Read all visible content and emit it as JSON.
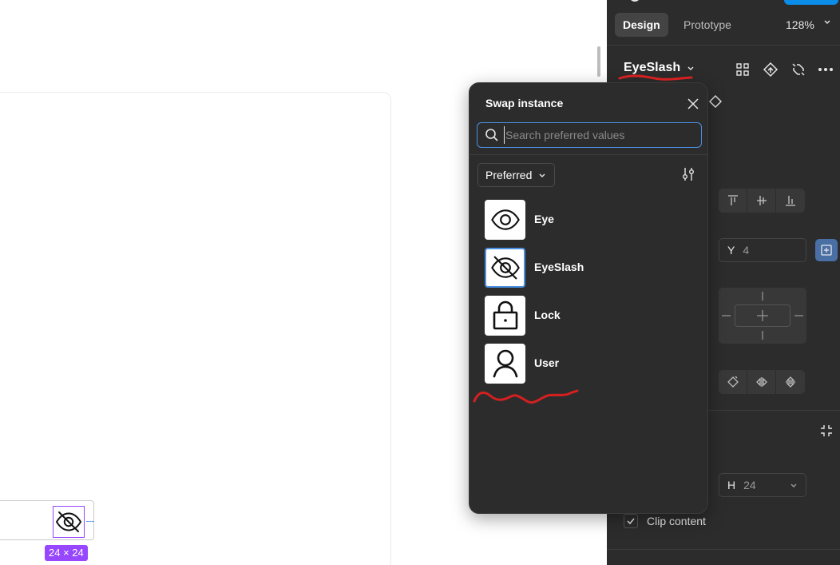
{
  "panel": {
    "tabs": {
      "design": "Design",
      "prototype": "Prototype"
    },
    "zoom": "128%",
    "component_name": "EyeSlash",
    "y_field": {
      "label": "Y",
      "value": "4"
    },
    "h_field": {
      "label": "H",
      "value": "24"
    },
    "clip_content": {
      "label": "Clip content",
      "checked": true
    }
  },
  "canvas": {
    "size_badge": "24 × 24",
    "selected_icon": "eye-slash-icon"
  },
  "popup": {
    "title": "Swap instance",
    "search_placeholder": "Search preferred values",
    "filter_label": "Preferred",
    "items": [
      {
        "label": "Eye",
        "icon": "eye-icon",
        "selected": false
      },
      {
        "label": "EyeSlash",
        "icon": "eye-slash-icon",
        "selected": true
      },
      {
        "label": "Lock",
        "icon": "lock-icon",
        "selected": false
      },
      {
        "label": "User",
        "icon": "user-icon",
        "selected": false
      }
    ]
  },
  "colors": {
    "panel_bg": "#2c2c2c",
    "selection": "#9747ff",
    "focus_blue": "#4a90e2",
    "annotation_red": "#d42020"
  }
}
